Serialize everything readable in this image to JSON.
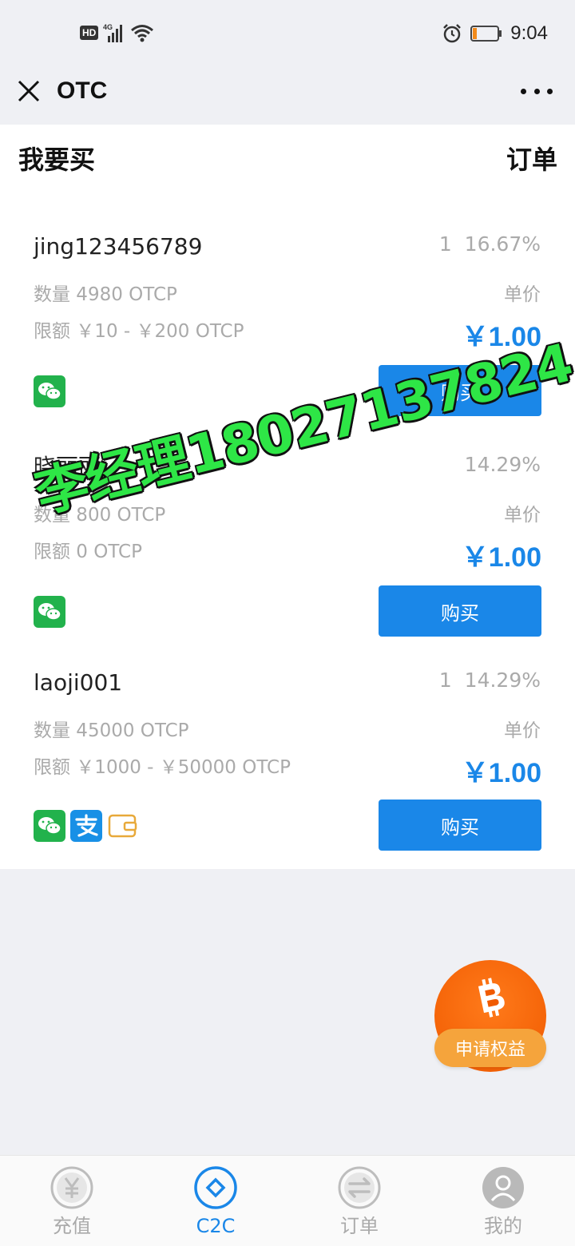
{
  "status_bar": {
    "hd": "HD",
    "network": "4G",
    "time": "9:04",
    "battery_level": 0.15
  },
  "header": {
    "title": "OTC"
  },
  "section": {
    "title": "我要买",
    "orders_link": "订单"
  },
  "listings": [
    {
      "name": "jing123456789",
      "rate": "1 16.67%",
      "quantity": "数量 4980 OTCP",
      "limit": "限额 ￥10 - ￥200 OTCP",
      "unit_label": "单价",
      "price": "￥1.00",
      "buy_label": "购买",
      "payment_icons": [
        "wechat-pay-icon"
      ]
    },
    {
      "name": "晓丽丽",
      "rate": "14.29%",
      "quantity": "数量 800 OTCP",
      "limit": "限额 0 OTCP",
      "unit_label": "单价",
      "price": "￥1.00",
      "buy_label": "购买",
      "payment_icons": [
        "wechat-pay-icon"
      ]
    },
    {
      "name": "laoji001",
      "rate": "1 14.29%",
      "quantity": "数量 45000 OTCP",
      "limit": "限额 ￥1000 - ￥50000 OTCP",
      "unit_label": "单价",
      "price": "￥1.00",
      "buy_label": "购买",
      "payment_icons": [
        "wechat-pay-icon",
        "alipay-icon",
        "wallet-icon"
      ]
    }
  ],
  "watermark": "李经理18027137824",
  "fab": {
    "label": "申请权益",
    "icon": "bitcoin-icon"
  },
  "bottom_nav": [
    {
      "label": "充值",
      "icon": "yen-circle-icon",
      "active": false
    },
    {
      "label": "C2C",
      "icon": "diamond-circle-icon",
      "active": true
    },
    {
      "label": "订单",
      "icon": "swap-arrows-icon",
      "active": false
    },
    {
      "label": "我的",
      "icon": "user-profile-icon",
      "active": false
    }
  ],
  "colors": {
    "accent": "#1a87e8",
    "wechat": "#22b24c",
    "alipay": "#1890e6",
    "fab": "#f05a00",
    "fab_label": "#f5a43c",
    "watermark": "#2ee646"
  }
}
